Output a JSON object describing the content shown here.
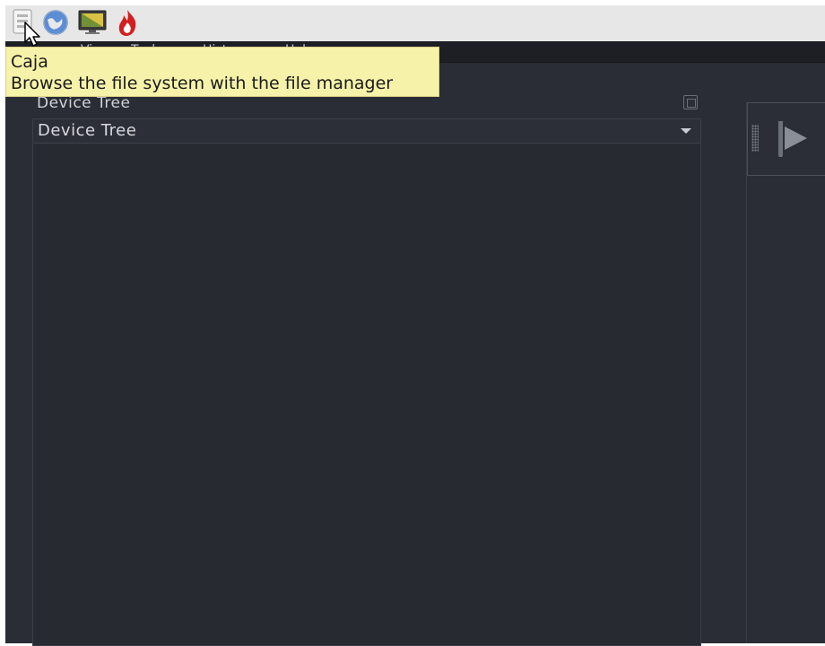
{
  "top_panel": {
    "launchers": [
      {
        "name": "caja",
        "icon": "file-manager-icon"
      },
      {
        "name": "browser",
        "icon": "globe-icon"
      },
      {
        "name": "terminal",
        "icon": "monitor-icon"
      },
      {
        "name": "burner",
        "icon": "flame-icon"
      }
    ]
  },
  "menubar": {
    "items": [
      "",
      "View",
      "Tools",
      "History",
      "Help"
    ]
  },
  "left_pane": {
    "dock_title": "Device Tree",
    "combo_value": "Device Tree"
  },
  "tooltip": {
    "title": "Caja",
    "description": "Browse the file system with the file manager"
  },
  "colors": {
    "window_bg": "#2a2d35",
    "menubar_bg": "#1d1f25",
    "tooltip_bg": "#f6f2a9",
    "panel_bg": "#e7e7e7"
  }
}
